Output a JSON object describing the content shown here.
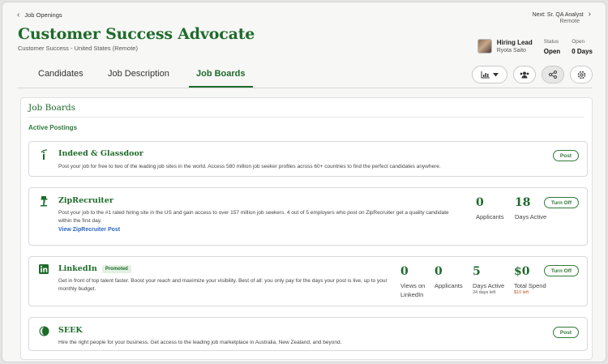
{
  "nav": {
    "back_label": "Job Openings",
    "next_label": "Next: Sr. QA Analyst",
    "next_sub": "Remote"
  },
  "job": {
    "title": "Customer Success Advocate",
    "subtitle": "Customer Success - United States (Remote)"
  },
  "meta": {
    "lead_key": "Hiring Lead",
    "lead_value": "Ryota Saito",
    "status_key": "Status",
    "status_value": "Open",
    "open_key": "Open",
    "open_value": "0 Days"
  },
  "tabs": [
    {
      "label": "Candidates",
      "active": false
    },
    {
      "label": "Job Description",
      "active": false
    },
    {
      "label": "Job Boards",
      "active": true
    }
  ],
  "icons": {
    "back": "chevron-left-icon",
    "next": "chevron-right-icon",
    "chart": "bar-chart-icon",
    "dropdown": "caret-down-icon",
    "users": "users-icon",
    "share": "share-icon",
    "settings": "gear-icon"
  },
  "panel": {
    "title": "Job Boards",
    "section": "Active Postings"
  },
  "boards": [
    {
      "name": "Indeed & Glassdoor",
      "icon": "indeed-logo-icon",
      "desc": "Post your job for free to two of the leading job sites in the world. Access 580 million job seeker profiles across 60+ countries to find the perfect candidates anywhere.",
      "action": "Post"
    },
    {
      "name": "ZipRecruiter",
      "icon": "ziprecruiter-logo-icon",
      "desc": "Post your job to the #1 rated hiring site in the US and gain access to over 157 million job seekers. 4 out of 5 employers who post on ZipRecruiter get a quality candidate within the first day.",
      "link": "View ZipRecruiter Post",
      "action": "Turn Off",
      "metrics": [
        {
          "value": "0",
          "label": "Applicants"
        },
        {
          "value": "18",
          "label": "Days Active"
        }
      ]
    },
    {
      "name": "LinkedIn",
      "badge": "Promoted",
      "icon": "linkedin-logo-icon",
      "desc": "Get in front of top talent faster. Boost your reach and maximize your visibility. Best of all: you only pay for the days your post is live, up to your monthly budget.",
      "action": "Turn Off",
      "metrics": [
        {
          "value": "0",
          "label": "Views on LinkedIn"
        },
        {
          "value": "0",
          "label": "Applicants"
        },
        {
          "value": "5",
          "label": "Days Active",
          "note": "24 days left"
        },
        {
          "value": "$0",
          "label": "Total Spend",
          "note": "$10 left"
        }
      ]
    },
    {
      "name": "SEEK",
      "icon": "seek-logo-icon",
      "desc": "Hire the right people for your business. Get access to the leading job marketplace in Australia, New Zealand, and beyond.",
      "action": "Post"
    }
  ],
  "colors": {
    "brand": "#1f6b2b",
    "link": "#2a66c6",
    "warn": "#c0501e"
  }
}
